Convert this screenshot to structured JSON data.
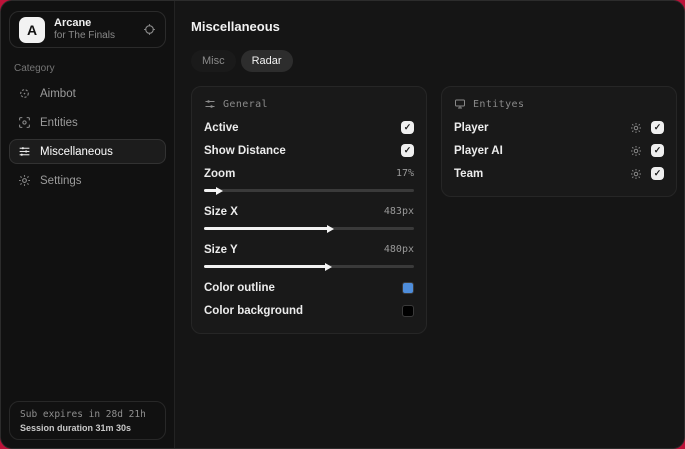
{
  "app": {
    "logo_letter": "A",
    "name": "Arcane",
    "subtitle": "for The Finals"
  },
  "sidebar": {
    "category_label": "Category",
    "items": [
      {
        "label": "Aimbot",
        "icon": "crosshair-icon",
        "active": false
      },
      {
        "label": "Entities",
        "icon": "scan-icon",
        "active": false
      },
      {
        "label": "Miscellaneous",
        "icon": "sliders-icon",
        "active": true
      },
      {
        "label": "Settings",
        "icon": "gear-icon",
        "active": false
      }
    ],
    "status": {
      "sub_line": "Sub expires in 28d 21h",
      "session_line": "Session duration 31m 30s"
    }
  },
  "main": {
    "title": "Miscellaneous",
    "tabs": [
      {
        "label": "Misc",
        "active": false
      },
      {
        "label": "Radar",
        "active": true
      }
    ],
    "panels": {
      "general": {
        "title": "General",
        "toggles": [
          {
            "label": "Active",
            "checked": true
          },
          {
            "label": "Show Distance",
            "checked": true
          }
        ],
        "sliders": [
          {
            "label": "Zoom",
            "value": "17%",
            "fill": "7%"
          },
          {
            "label": "Size X",
            "value": "483px",
            "fill": "60%"
          },
          {
            "label": "Size Y",
            "value": "480px",
            "fill": "59%"
          }
        ],
        "color_rows": [
          {
            "label": "Color outline",
            "swatch": "#4e8ddb"
          },
          {
            "label": "Color background",
            "swatch": "#000000"
          }
        ]
      },
      "entities": {
        "title": "Entityes",
        "rows": [
          {
            "label": "Player",
            "checked": true
          },
          {
            "label": "Player AI",
            "checked": true
          },
          {
            "label": "Team",
            "checked": true
          }
        ]
      }
    }
  },
  "colors": {
    "desktop_background": "#bd1239",
    "outline_swatch": "#4e8ddb",
    "background_swatch": "#000000"
  }
}
